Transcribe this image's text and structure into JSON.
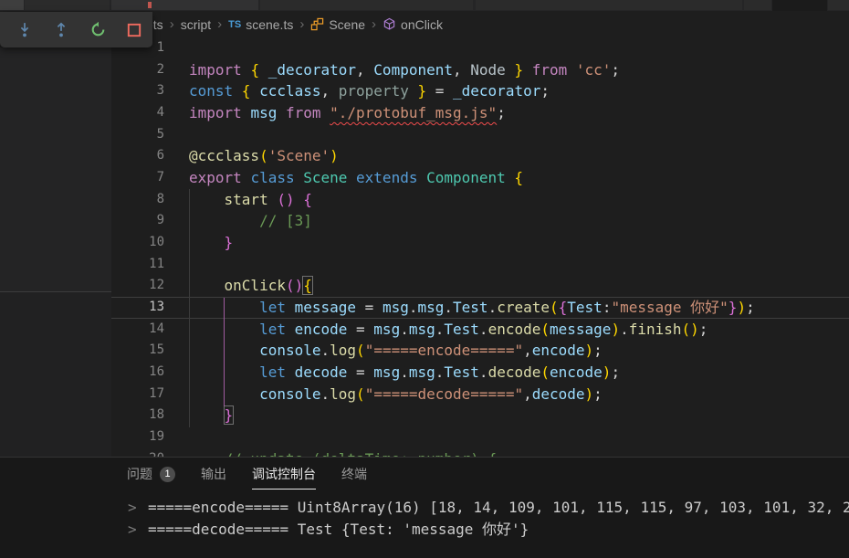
{
  "breadcrumb": {
    "separator": "›",
    "items": [
      {
        "label": "ets",
        "icon": null
      },
      {
        "label": "script",
        "icon": null
      },
      {
        "label": "scene.ts",
        "icon": "typescript-file"
      },
      {
        "label": "Scene",
        "icon": "class-symbol"
      },
      {
        "label": "onClick",
        "icon": "method-symbol"
      }
    ]
  },
  "debug_toolbar": {
    "buttons": [
      {
        "id": "step-into"
      },
      {
        "id": "step-out"
      },
      {
        "id": "restart"
      },
      {
        "id": "stop"
      }
    ]
  },
  "colors": {
    "keyword_blue": "#569CD6",
    "keyword_pink": "#C586C0",
    "variable_blue": "#9CDCFE",
    "class_teal": "#4EC9B0",
    "function_yellow": "#DCDCAA",
    "string_orange": "#CE9178",
    "comment_green": "#6A9955",
    "bracket_gold": "#FFD700",
    "bracket_orchid": "#DA70D6",
    "error_squiggle_red": "#f14c4c",
    "step_icon_blue": "#5f87ad",
    "restart_icon_green": "#6fbe6f",
    "stop_icon_red": "#ef6a5e",
    "class_icon_orange": "#ee9d28",
    "method_icon_purple": "#b180d7"
  },
  "editor": {
    "current_line": 13,
    "lines": [
      {
        "n": 1,
        "tokens": []
      },
      {
        "n": 2,
        "tokens": [
          [
            "import ",
            "kw2"
          ],
          [
            "{ ",
            "b1"
          ],
          [
            "_decorator",
            "var"
          ],
          [
            ", ",
            "pl"
          ],
          [
            "Component",
            "var"
          ],
          [
            ", ",
            "pl"
          ],
          [
            "Node",
            "dim1"
          ],
          [
            " ",
            "pl"
          ],
          [
            "}",
            "b1"
          ],
          [
            " ",
            "pl"
          ],
          [
            "from",
            "kw2"
          ],
          [
            " ",
            "pl"
          ],
          [
            "'cc'",
            "str"
          ],
          [
            ";",
            "pl"
          ]
        ]
      },
      {
        "n": 3,
        "tokens": [
          [
            "const ",
            "kw1"
          ],
          [
            "{ ",
            "b1"
          ],
          [
            "ccclass",
            "var"
          ],
          [
            ", ",
            "pl"
          ],
          [
            "property",
            "dim2"
          ],
          [
            " ",
            "pl"
          ],
          [
            "}",
            "b1"
          ],
          [
            " = ",
            "pl"
          ],
          [
            "_decorator",
            "var"
          ],
          [
            ";",
            "pl"
          ]
        ]
      },
      {
        "n": 4,
        "tokens": [
          [
            "import ",
            "kw2"
          ],
          [
            "msg",
            "var"
          ],
          [
            " ",
            "pl"
          ],
          [
            "from ",
            "kw2"
          ],
          [
            "\"./protobuf_msg.js\"",
            "strE"
          ],
          [
            ";",
            "pl"
          ]
        ]
      },
      {
        "n": 5,
        "tokens": []
      },
      {
        "n": 6,
        "tokens": [
          [
            "@ccclass",
            "fn"
          ],
          [
            "(",
            "b1"
          ],
          [
            "'Scene'",
            "str"
          ],
          [
            ")",
            "b1"
          ]
        ]
      },
      {
        "n": 7,
        "tokens": [
          [
            "export ",
            "kw2"
          ],
          [
            "class ",
            "kw1"
          ],
          [
            "Scene ",
            "cls"
          ],
          [
            "extends ",
            "kw1"
          ],
          [
            "Component ",
            "cls"
          ],
          [
            "{",
            "b1"
          ]
        ]
      },
      {
        "n": 8,
        "tokens": [
          [
            "    ",
            "pl"
          ],
          [
            "start ",
            "fn"
          ],
          [
            "()",
            "b2"
          ],
          [
            " ",
            "pl"
          ],
          [
            "{",
            "b2"
          ]
        ]
      },
      {
        "n": 9,
        "tokens": [
          [
            "        // [3]",
            "cmt"
          ]
        ]
      },
      {
        "n": 10,
        "tokens": [
          [
            "    ",
            "pl"
          ],
          [
            "}",
            "b2"
          ]
        ]
      },
      {
        "n": 11,
        "tokens": []
      },
      {
        "n": 12,
        "tokens": [
          [
            "    ",
            "pl"
          ],
          [
            "onClick",
            "fn"
          ],
          [
            "()",
            "b2"
          ],
          [
            "{",
            "b1x"
          ]
        ]
      },
      {
        "n": 13,
        "tokens": [
          [
            "        ",
            "pl"
          ],
          [
            "let ",
            "kw1"
          ],
          [
            "message",
            "var"
          ],
          [
            " = ",
            "pl"
          ],
          [
            "msg",
            "var"
          ],
          [
            ".",
            "pl"
          ],
          [
            "msg",
            "var"
          ],
          [
            ".",
            "pl"
          ],
          [
            "Test",
            "var"
          ],
          [
            ".",
            "pl"
          ],
          [
            "create",
            "fn"
          ],
          [
            "(",
            "b1"
          ],
          [
            "{",
            "b2"
          ],
          [
            "Test",
            "var"
          ],
          [
            ":",
            "pl"
          ],
          [
            "\"message 你好\"",
            "str"
          ],
          [
            "}",
            "b2"
          ],
          [
            ")",
            "b1"
          ],
          [
            ";",
            "pl"
          ]
        ]
      },
      {
        "n": 14,
        "tokens": [
          [
            "        ",
            "pl"
          ],
          [
            "let ",
            "kw1"
          ],
          [
            "encode",
            "var"
          ],
          [
            " = ",
            "pl"
          ],
          [
            "msg",
            "var"
          ],
          [
            ".",
            "pl"
          ],
          [
            "msg",
            "var"
          ],
          [
            ".",
            "pl"
          ],
          [
            "Test",
            "var"
          ],
          [
            ".",
            "pl"
          ],
          [
            "encode",
            "fn"
          ],
          [
            "(",
            "b1"
          ],
          [
            "message",
            "var"
          ],
          [
            ")",
            "b1"
          ],
          [
            ".",
            "pl"
          ],
          [
            "finish",
            "fn"
          ],
          [
            "()",
            "b1"
          ],
          [
            ";",
            "pl"
          ]
        ]
      },
      {
        "n": 15,
        "tokens": [
          [
            "        ",
            "pl"
          ],
          [
            "console",
            "var"
          ],
          [
            ".",
            "pl"
          ],
          [
            "log",
            "fn"
          ],
          [
            "(",
            "b1"
          ],
          [
            "\"=====encode=====\"",
            "str"
          ],
          [
            ",",
            "pl"
          ],
          [
            "encode",
            "var"
          ],
          [
            ")",
            "b1"
          ],
          [
            ";",
            "pl"
          ]
        ]
      },
      {
        "n": 16,
        "tokens": [
          [
            "        ",
            "pl"
          ],
          [
            "let ",
            "kw1"
          ],
          [
            "decode",
            "var"
          ],
          [
            " = ",
            "pl"
          ],
          [
            "msg",
            "var"
          ],
          [
            ".",
            "pl"
          ],
          [
            "msg",
            "var"
          ],
          [
            ".",
            "pl"
          ],
          [
            "Test",
            "var"
          ],
          [
            ".",
            "pl"
          ],
          [
            "decode",
            "fn"
          ],
          [
            "(",
            "b1"
          ],
          [
            "encode",
            "var"
          ],
          [
            ")",
            "b1"
          ],
          [
            ";",
            "pl"
          ]
        ]
      },
      {
        "n": 17,
        "tokens": [
          [
            "        ",
            "pl"
          ],
          [
            "console",
            "var"
          ],
          [
            ".",
            "pl"
          ],
          [
            "log",
            "fn"
          ],
          [
            "(",
            "b1"
          ],
          [
            "\"=====decode=====\"",
            "str"
          ],
          [
            ",",
            "pl"
          ],
          [
            "decode",
            "var"
          ],
          [
            ")",
            "b1"
          ],
          [
            ";",
            "pl"
          ]
        ]
      },
      {
        "n": 18,
        "tokens": [
          [
            "    ",
            "pl"
          ],
          [
            "}",
            "b2x"
          ]
        ]
      },
      {
        "n": 19,
        "tokens": []
      }
    ],
    "clipped_line": {
      "n": 20,
      "tokens": [
        [
          "    // update (deltaTime: number) {",
          "cmt"
        ]
      ]
    }
  },
  "panel": {
    "tabs": [
      {
        "label": "问题",
        "badge": "1",
        "active": false
      },
      {
        "label": "输出",
        "active": false
      },
      {
        "label": "调试控制台",
        "active": true
      },
      {
        "label": "终端",
        "active": false
      }
    ],
    "console_rows": [
      {
        "prefix": ">",
        "text": "=====encode===== Uint8Array(16) [18, 14, 109, 101, 115, 115, 97, 103, 101, 32, 2"
      },
      {
        "prefix": ">",
        "text": "=====decode===== Test {Test: 'message 你好'}"
      }
    ]
  }
}
